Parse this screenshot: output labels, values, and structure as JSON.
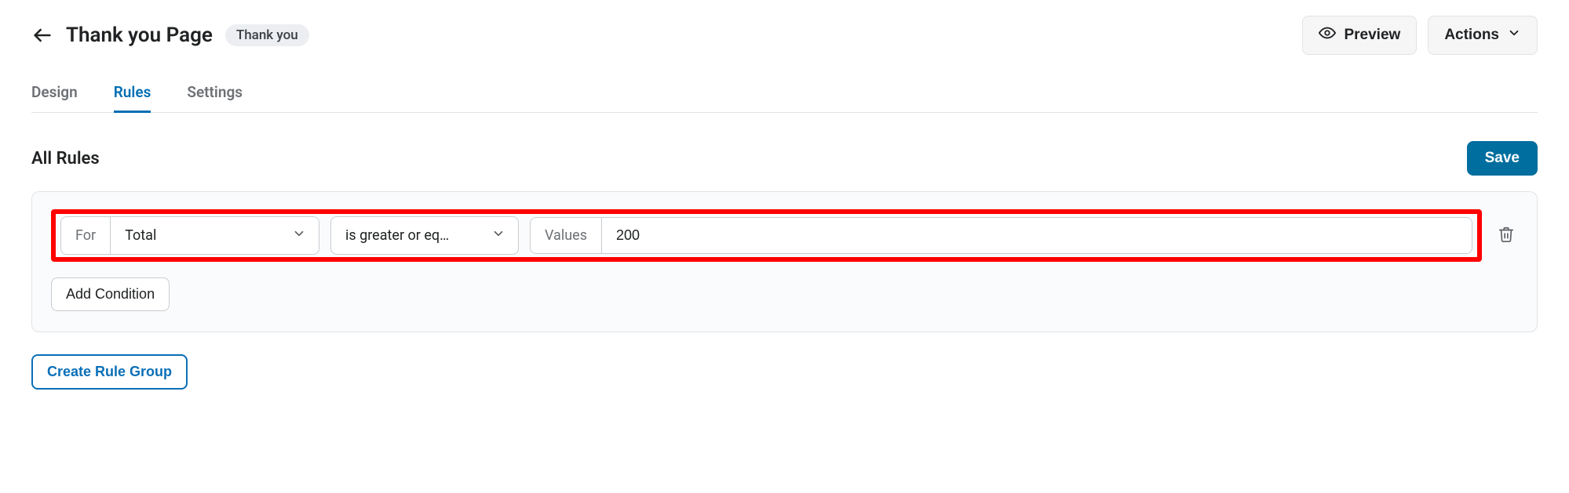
{
  "header": {
    "title": "Thank you Page",
    "badge": "Thank you",
    "preview_label": "Preview",
    "actions_label": "Actions"
  },
  "tabs": [
    {
      "id": "design",
      "label": "Design",
      "active": false
    },
    {
      "id": "rules",
      "label": "Rules",
      "active": true
    },
    {
      "id": "settings",
      "label": "Settings",
      "active": false
    }
  ],
  "section": {
    "title": "All Rules",
    "save_label": "Save"
  },
  "rule_group": {
    "condition": {
      "for_prefix": "For",
      "for_value": "Total",
      "operator_value": "is greater or eq…",
      "values_prefix": "Values",
      "value": "200"
    },
    "add_condition_label": "Add Condition"
  },
  "footer": {
    "create_group_label": "Create Rule Group"
  }
}
